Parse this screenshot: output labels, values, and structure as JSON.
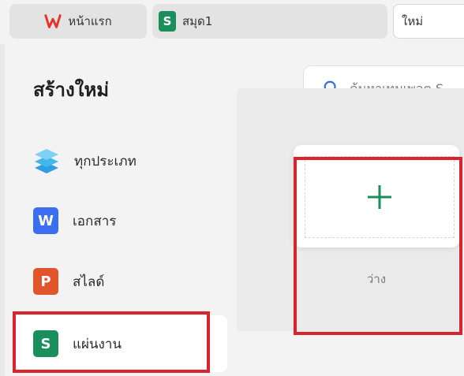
{
  "tabs": {
    "home_label": "หน้าแรก",
    "book_label": "สมุด1",
    "book_badge": "S",
    "new_label": "ใหม่"
  },
  "panel": {
    "title": "สร้างใหม่"
  },
  "search": {
    "placeholder": "ค้นหาเทมเพลต S"
  },
  "categories": [
    {
      "label": "ทุกประเภท",
      "icon": "layers-icon"
    },
    {
      "label": "เอกสาร",
      "icon": "word-icon",
      "badge": "W"
    },
    {
      "label": "สไลด์",
      "icon": "slide-icon",
      "badge": "P"
    },
    {
      "label": "แผ่นงาน",
      "icon": "sheet-icon",
      "badge": "S",
      "active": true
    }
  ],
  "blank_card": {
    "label": "ว่าง"
  },
  "colors": {
    "accent_green": "#1a8f5b",
    "highlight_red": "#d9232d",
    "word_blue": "#3b6ff0",
    "slide_orange": "#e0552c"
  }
}
